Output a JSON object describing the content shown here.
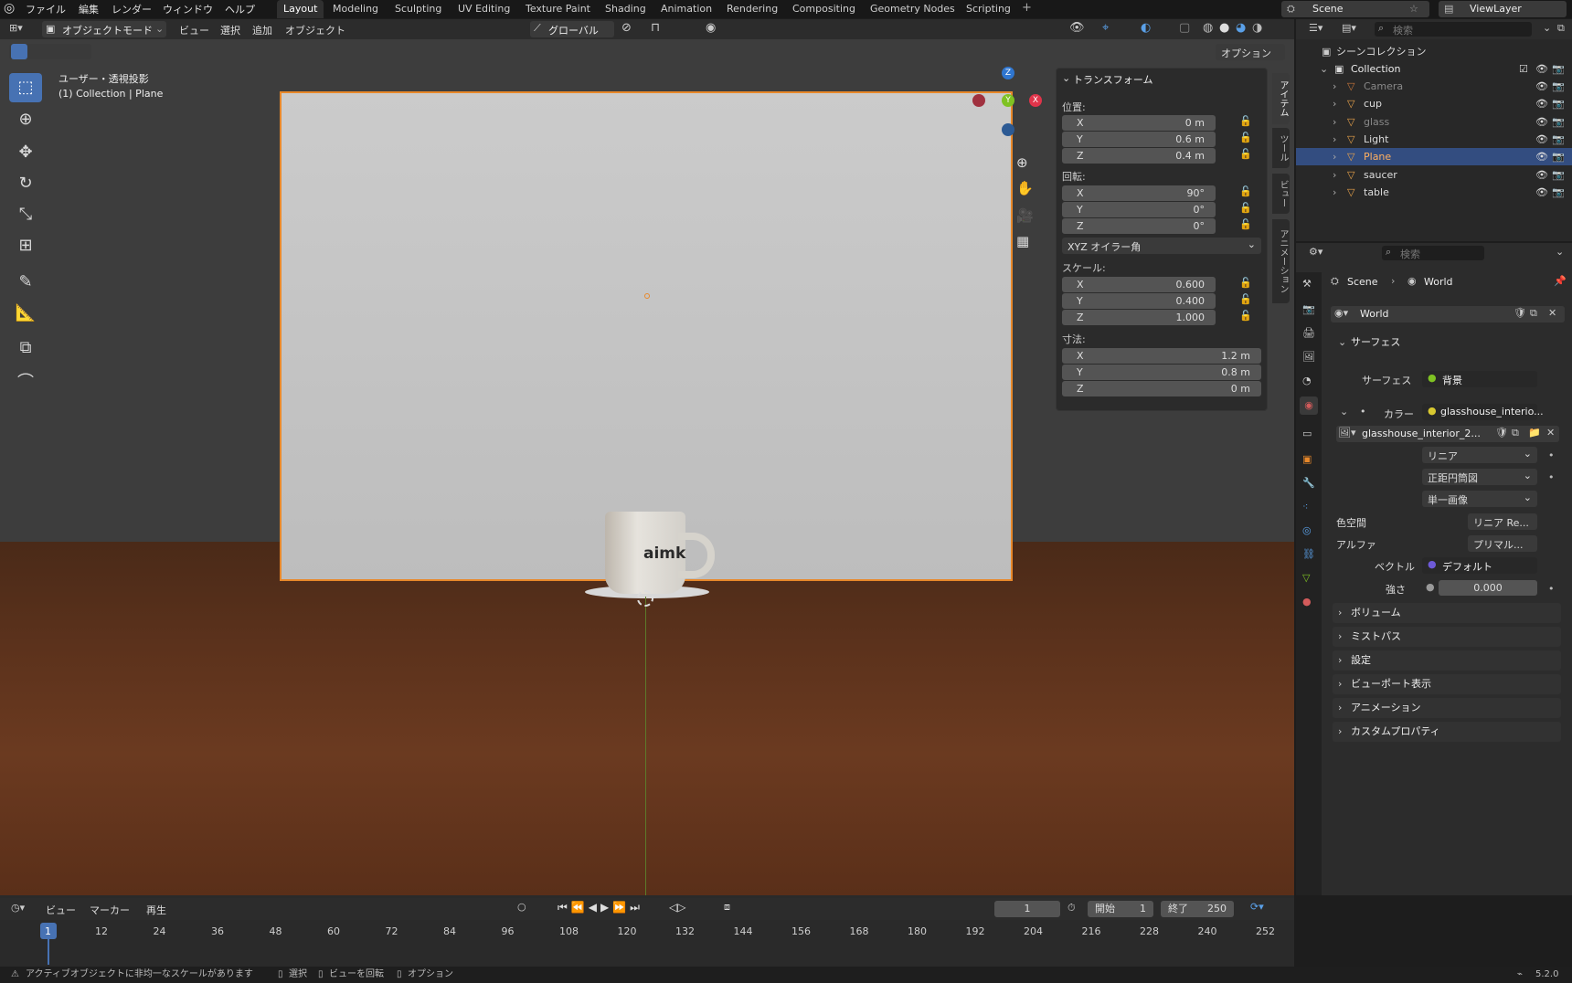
{
  "top_menu": {
    "items": [
      "ファイル",
      "編集",
      "レンダー",
      "ウィンドウ",
      "ヘルプ"
    ]
  },
  "workspaces": [
    "Layout",
    "Modeling",
    "Sculpting",
    "UV Editing",
    "Texture Paint",
    "Shading",
    "Animation",
    "Rendering",
    "Compositing",
    "Geometry Nodes",
    "Scripting"
  ],
  "scene_name": "Scene",
  "viewlayer_name": "ViewLayer",
  "viewport_header": {
    "mode": "オブジェクトモード",
    "menus": [
      "ビュー",
      "選択",
      "追加",
      "オブジェクト"
    ],
    "orientation": "グローバル",
    "options": "オプション"
  },
  "viewport": {
    "view_label": "ユーザー・透視投影",
    "collection_label": "(1) Collection | Plane",
    "mug_text": "aimk"
  },
  "gizmo": {
    "z": "Z",
    "y": "Y",
    "x": "X"
  },
  "npanel": {
    "title": "トランスフォーム",
    "location_label": "位置:",
    "location": [
      {
        "axis": "X",
        "value": "0 m"
      },
      {
        "axis": "Y",
        "value": "0.6 m"
      },
      {
        "axis": "Z",
        "value": "0.4 m"
      }
    ],
    "rotation_label": "回転:",
    "rotation": [
      {
        "axis": "X",
        "value": "90°"
      },
      {
        "axis": "Y",
        "value": "0°"
      },
      {
        "axis": "Z",
        "value": "0°"
      }
    ],
    "rotation_mode": "XYZ オイラー角",
    "scale_label": "スケール:",
    "scale": [
      {
        "axis": "X",
        "value": "0.600"
      },
      {
        "axis": "Y",
        "value": "0.400"
      },
      {
        "axis": "Z",
        "value": "1.000"
      }
    ],
    "dims_label": "寸法:",
    "dimensions": [
      {
        "axis": "X",
        "value": "1.2 m"
      },
      {
        "axis": "Y",
        "value": "0.8 m"
      },
      {
        "axis": "Z",
        "value": "0 m"
      }
    ]
  },
  "side_tabs": [
    "アイテム",
    "ツール",
    "ビュー",
    "アニメーション"
  ],
  "outliner": {
    "search_placeholder": "検索",
    "root": "シーンコレクション",
    "collection": "Collection",
    "items": [
      {
        "name": "Camera",
        "selected": false,
        "color": "#c9763a"
      },
      {
        "name": "cup",
        "selected": false,
        "color": "#e8a24a"
      },
      {
        "name": "glass",
        "selected": false,
        "color": "#e8a24a"
      },
      {
        "name": "Light",
        "selected": false,
        "color": "#e8a24a"
      },
      {
        "name": "Plane",
        "selected": true,
        "color": "#e8a24a"
      },
      {
        "name": "saucer",
        "selected": false,
        "color": "#e8a24a"
      },
      {
        "name": "table",
        "selected": false,
        "color": "#e8a24a"
      }
    ]
  },
  "properties": {
    "search_placeholder": "検索",
    "breadcrumb_scene": "Scene",
    "breadcrumb_world": "World",
    "world_name": "World",
    "surface_section": "サーフェス",
    "surface_label": "サーフェス",
    "surface_value": "背景",
    "color_label": "カラー",
    "color_value": "glasshouse_interio...",
    "image_name": "glasshouse_interior_2...",
    "interp": "リニア",
    "projection": "正距円筒図",
    "source": "単一画像",
    "colorspace_label": "色空間",
    "colorspace_value": "リニア Re...",
    "alpha_label": "アルファ",
    "alpha_value": "プリマル...",
    "vector_label": "ベクトル",
    "vector_value": "デフォルト",
    "strength_label": "強さ",
    "strength_value": "0.000",
    "sections": [
      "ボリューム",
      "ミストパス",
      "設定",
      "ビューポート表示",
      "アニメーション",
      "カスタムプロパティ"
    ]
  },
  "timeline": {
    "menus": [
      "ビュー",
      "マーカー",
      "再生"
    ],
    "current_frame": "1",
    "start_label": "開始",
    "start": "1",
    "end_label": "終了",
    "end": "250",
    "ticks": [
      "1",
      "12",
      "24",
      "36",
      "48",
      "60",
      "72",
      "84",
      "96",
      "108",
      "120",
      "132",
      "144",
      "156",
      "168",
      "180",
      "192",
      "204",
      "216",
      "228",
      "240",
      "252"
    ]
  },
  "statusbar": {
    "warning": "アクティブオブジェクトに非均一なスケールがあります",
    "hint_select": "選択",
    "hint_rotate": "ビューを回転",
    "hint_options": "オプション",
    "version": "5.2.0"
  }
}
